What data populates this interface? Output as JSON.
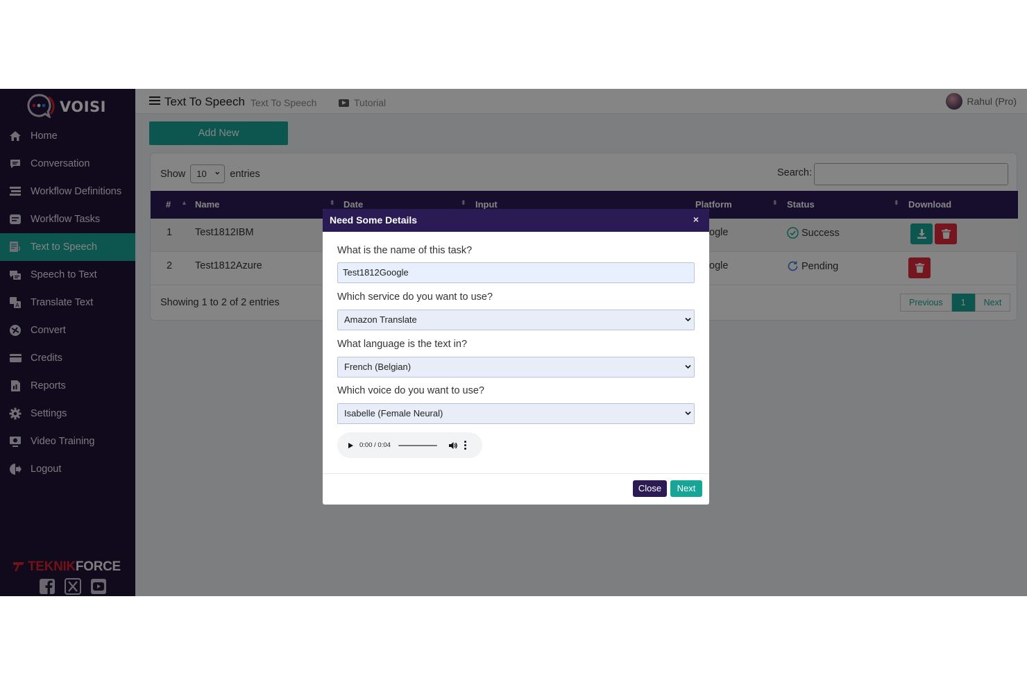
{
  "app": {
    "logo_text": "VOISI",
    "brand_bottom_part1": "TEKNIK",
    "brand_bottom_part2": "FORCE"
  },
  "sidebar": {
    "items": [
      {
        "label": "Home",
        "icon": "home-icon"
      },
      {
        "label": "Conversation",
        "icon": "chat-icon"
      },
      {
        "label": "Workflow Definitions",
        "icon": "workflow-icon"
      },
      {
        "label": "Workflow Tasks",
        "icon": "tasks-icon"
      },
      {
        "label": "Text to Speech",
        "icon": "text-to-speech-icon",
        "active": true
      },
      {
        "label": "Speech to Text",
        "icon": "speech-to-text-icon"
      },
      {
        "label": "Translate Text",
        "icon": "translate-icon"
      },
      {
        "label": "Convert",
        "icon": "convert-icon"
      },
      {
        "label": "Credits",
        "icon": "credit-card-icon"
      },
      {
        "label": "Reports",
        "icon": "reports-icon"
      },
      {
        "label": "Settings",
        "icon": "gear-icon"
      },
      {
        "label": "Video Training",
        "icon": "video-icon"
      },
      {
        "label": "Logout",
        "icon": "logout-icon"
      }
    ],
    "socials": [
      "facebook-icon",
      "x-icon",
      "youtube-icon"
    ]
  },
  "header": {
    "title": "Text To Speech",
    "subtitle": "Text To Speech",
    "tutorial": "Tutorial",
    "user": "Rahul (Pro)"
  },
  "toolbar": {
    "add_new": "Add New"
  },
  "table": {
    "show_label": "Show",
    "show_value": "10",
    "entries_label": "entries",
    "search_label": "Search:",
    "columns": [
      "#",
      "Name",
      "Date",
      "Input",
      "Platform",
      "Status",
      "Download"
    ],
    "rows": [
      {
        "num": "1",
        "name": "Test1812IBM",
        "platform": "ogle",
        "status": "Success"
      },
      {
        "num": "2",
        "name": "Test1812Azure",
        "platform": "ogle",
        "status": "Pending"
      }
    ],
    "info": "Showing 1 to 2 of 2 entries",
    "pager": {
      "previous": "Previous",
      "page": "1",
      "next": "Next"
    }
  },
  "modal": {
    "title": "Need Some Details",
    "close_x": "×",
    "q1": "What is the name of this task?",
    "task_name": "Test1812Google",
    "q2": "Which service do you want to use?",
    "service": "Amazon Translate",
    "q3": "What language is the text in?",
    "language": "French (Belgian)",
    "q4": "Which voice do you want to use?",
    "voice": "Isabelle (Female Neural)",
    "audio_time": "0:00 / 0:04",
    "close_label": "Close",
    "next_label": "Next"
  },
  "colors": {
    "sidebar": "#1f1536",
    "accent": "#17a597",
    "header_purple": "#2b1b55",
    "danger": "#e02b3b"
  }
}
